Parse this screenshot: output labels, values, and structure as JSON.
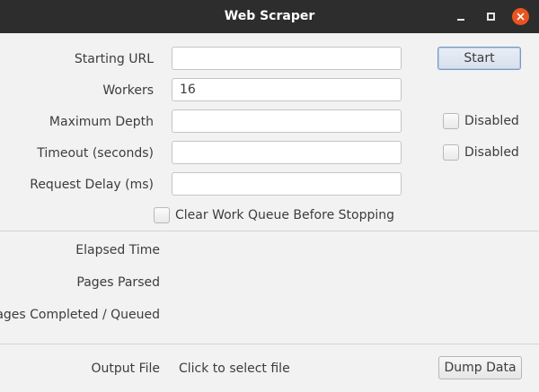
{
  "window": {
    "title": "Web Scraper"
  },
  "form": {
    "starting_url": {
      "label": "Starting URL",
      "value": ""
    },
    "workers": {
      "label": "Workers",
      "value": "16"
    },
    "max_depth": {
      "label": "Maximum Depth",
      "value": "",
      "disabled_label": "Disabled"
    },
    "timeout": {
      "label": "Timeout (seconds)",
      "value": "",
      "disabled_label": "Disabled"
    },
    "request_delay": {
      "label": "Request Delay (ms)",
      "value": ""
    },
    "clear_queue_label": "Clear Work Queue Before Stopping",
    "start_label": "Start"
  },
  "stats": {
    "elapsed_time_label": "Elapsed Time",
    "pages_parsed_label": "Pages Parsed",
    "pages_completed_label": "Pages Completed / Queued"
  },
  "output": {
    "label": "Output File",
    "file_text": "Click to select file",
    "dump_label": "Dump Data"
  }
}
